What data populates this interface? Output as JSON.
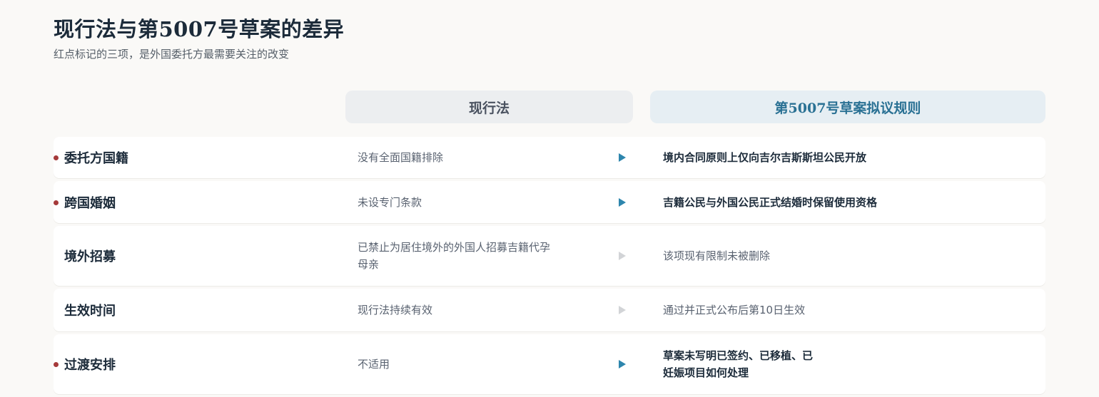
{
  "title": "现行法与第5007号草案的差异",
  "subtitle": "红点标记的三项，是外国委托方最需要关注的改变",
  "columns": {
    "current": "现行法",
    "draft": "第5007号草案拟议规则"
  },
  "rows": [
    {
      "label": "委托方国籍",
      "current": "没有全面国籍排除",
      "draft": "境内合同原则上仅向吉尔吉斯斯坦公民开放",
      "flagged": true,
      "changed": true
    },
    {
      "label": "跨国婚姻",
      "current": "未设专门条款",
      "draft": "吉籍公民与外国公民正式结婚时保留使用资格",
      "flagged": true,
      "changed": true
    },
    {
      "label": "境外招募",
      "current": "已禁止为居住境外的外国人招募吉籍代孕母亲",
      "draft": "该项现有限制未被删除",
      "flagged": false,
      "changed": false
    },
    {
      "label": "生效时间",
      "current": "现行法持续有效",
      "draft": "通过并正式公布后第10日生效",
      "flagged": false,
      "changed": false
    },
    {
      "label": "过渡安排",
      "current": "不适用",
      "draft": "草案未写明已签约、已移植、已妊娠项目如何处理",
      "flagged": true,
      "changed": true
    }
  ],
  "colors": {
    "flag_dot": "#a53a3a",
    "arrow_active": "#2e86ad",
    "arrow_muted": "#d2d4d7",
    "draft_header_text": "#2a7194"
  },
  "icons": {
    "flag": "red-dot-icon",
    "arrow": "arrow-right-icon"
  }
}
